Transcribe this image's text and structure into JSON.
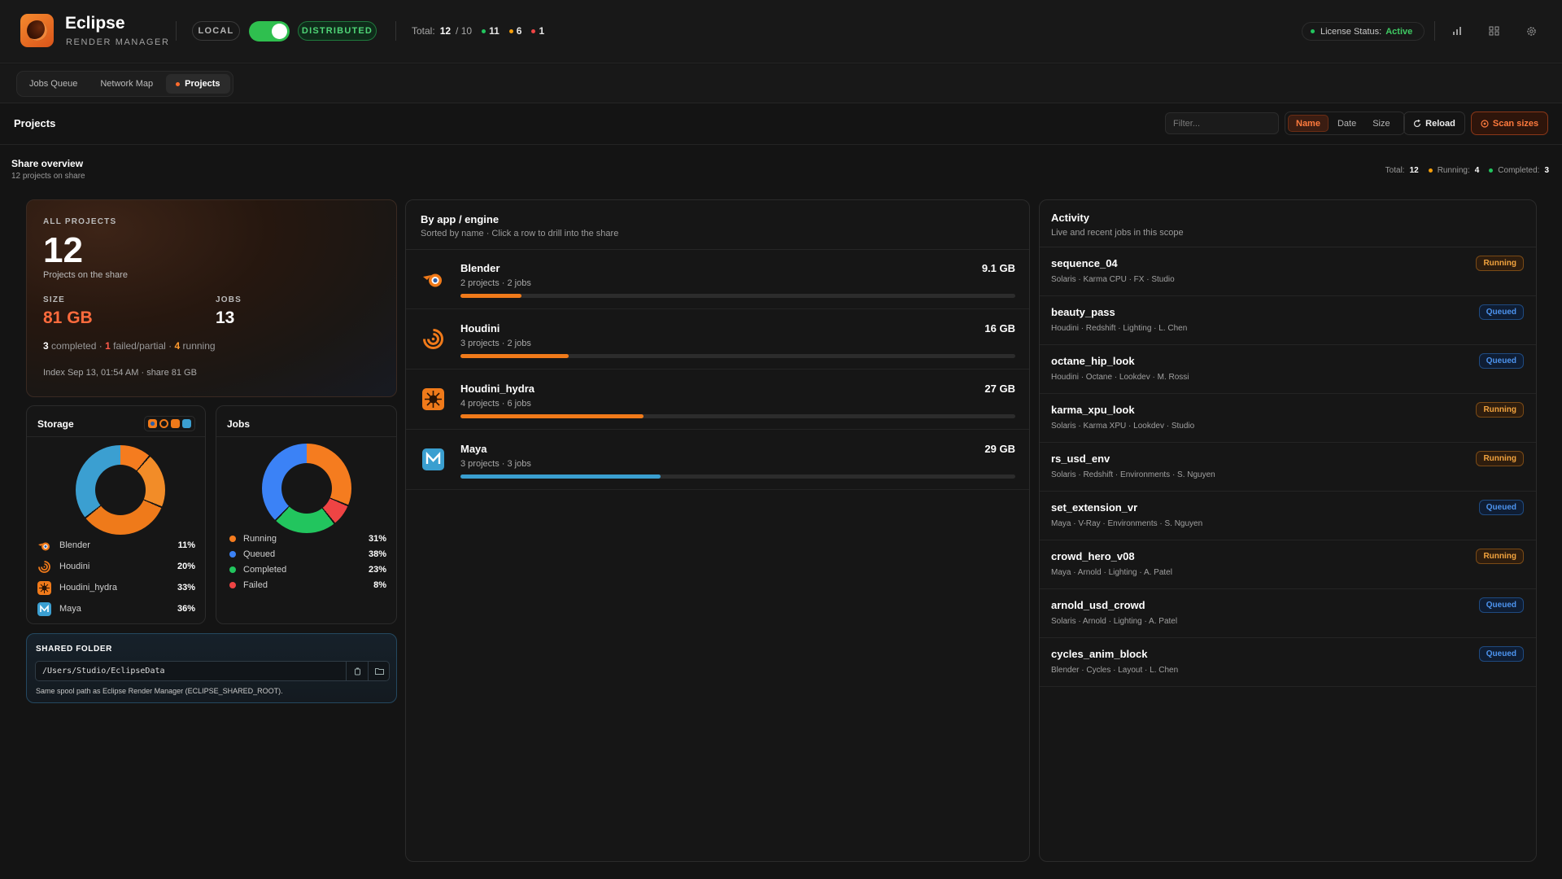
{
  "header": {
    "title": "Eclipse",
    "subtitle": "RENDER MANAGER",
    "mode_local": "LOCAL",
    "mode_distributed": "DISTRIBUTED",
    "total_label": "Total:",
    "total_value": "12",
    "total_max": "/ 10",
    "count_green": "11",
    "count_orange": "6",
    "count_red": "1",
    "license_label": "License Status:",
    "license_value": "Active",
    "icons": [
      "bar-chart-icon",
      "grid-icon",
      "gear-icon"
    ]
  },
  "tabs": [
    {
      "label": "Jobs Queue"
    },
    {
      "label": "Network Map"
    },
    {
      "label": "Projects"
    }
  ],
  "toolbar": {
    "title": "Projects",
    "filter_placeholder": "Filter...",
    "sort_options": [
      "Name",
      "Date",
      "Size"
    ],
    "reload_label": "Reload",
    "scan_label": "Scan sizes"
  },
  "overview": {
    "title": "Share overview",
    "subtitle": "12 projects on share",
    "total_label": "Total:",
    "total_value": "12",
    "running_label": "Running:",
    "running_value": "4",
    "completed_label": "Completed:",
    "completed_value": "3"
  },
  "hero": {
    "label": "ALL PROJECTS",
    "count": "12",
    "caption": "Projects on the share",
    "size_label": "SIZE",
    "size_value": "81 GB",
    "jobs_label": "JOBS",
    "jobs_value": "13",
    "completed_n": "3",
    "completed_t": "completed ·",
    "failed_n": "1",
    "failed_t": "failed/partial ·",
    "running_n": "4",
    "running_t": "running",
    "index": "Index Sep 13, 01:54 AM · share 81 GB"
  },
  "storage": {
    "title": "Storage",
    "items": [
      {
        "name": "Blender",
        "pct": "11%",
        "color": "#f0801f"
      },
      {
        "name": "Houdini",
        "pct": "20%",
        "color": "#f28c28"
      },
      {
        "name": "Houdini_hydra",
        "pct": "33%",
        "color": "#ef7a1a"
      },
      {
        "name": "Maya",
        "pct": "36%",
        "color": "#3b9fd1"
      }
    ]
  },
  "jobs": {
    "title": "Jobs",
    "items": [
      {
        "name": "Running",
        "pct": "31%",
        "color": "#f57c1f"
      },
      {
        "name": "Queued",
        "pct": "38%",
        "color": "#3b82f6"
      },
      {
        "name": "Completed",
        "pct": "23%",
        "color": "#22c55e"
      },
      {
        "name": "Failed",
        "pct": "8%",
        "color": "#ef4444"
      }
    ]
  },
  "shared": {
    "title": "SHARED FOLDER",
    "path": "/Users/Studio/EclipseData",
    "note": "Same spool path as Eclipse Render Manager (ECLIPSE_SHARED_ROOT)."
  },
  "engines": {
    "title": "By app / engine",
    "subtitle": "Sorted by name · Click a row to drill into the share",
    "items": [
      {
        "name": "Blender",
        "meta": "2 projects · 2 jobs",
        "size": "9.1 GB",
        "fill": 0.11,
        "color": "#f07a1a"
      },
      {
        "name": "Houdini",
        "meta": "3 projects · 2 jobs",
        "size": "16 GB",
        "fill": 0.195,
        "color": "#f07a1a"
      },
      {
        "name": "Houdini_hydra",
        "meta": "4 projects · 6 jobs",
        "size": "27 GB",
        "fill": 0.33,
        "color": "#f07a1a"
      },
      {
        "name": "Maya",
        "meta": "3 projects · 3 jobs",
        "size": "29 GB",
        "fill": 0.36,
        "color": "#3a9fd0"
      }
    ]
  },
  "activity": {
    "title": "Activity",
    "subtitle": "Live and recent jobs in this scope",
    "items": [
      {
        "name": "sequence_04",
        "meta": "Solaris · Karma CPU · FX · Studio",
        "status": "Running"
      },
      {
        "name": "beauty_pass",
        "meta": "Houdini · Redshift · Lighting · L. Chen",
        "status": "Queued"
      },
      {
        "name": "octane_hip_look",
        "meta": "Houdini · Octane · Lookdev · M. Rossi",
        "status": "Queued"
      },
      {
        "name": "karma_xpu_look",
        "meta": "Solaris · Karma XPU · Lookdev · Studio",
        "status": "Running"
      },
      {
        "name": "rs_usd_env",
        "meta": "Solaris · Redshift · Environments · S. Nguyen",
        "status": "Running"
      },
      {
        "name": "set_extension_vr",
        "meta": "Maya · V-Ray · Environments · S. Nguyen",
        "status": "Queued"
      },
      {
        "name": "crowd_hero_v08",
        "meta": "Maya · Arnold · Lighting · A. Patel",
        "status": "Running"
      },
      {
        "name": "arnold_usd_crowd",
        "meta": "Solaris · Arnold · Lighting · A. Patel",
        "status": "Queued"
      },
      {
        "name": "cycles_anim_block",
        "meta": "Blender · Cycles · Layout · L. Chen",
        "status": "Queued"
      }
    ]
  }
}
